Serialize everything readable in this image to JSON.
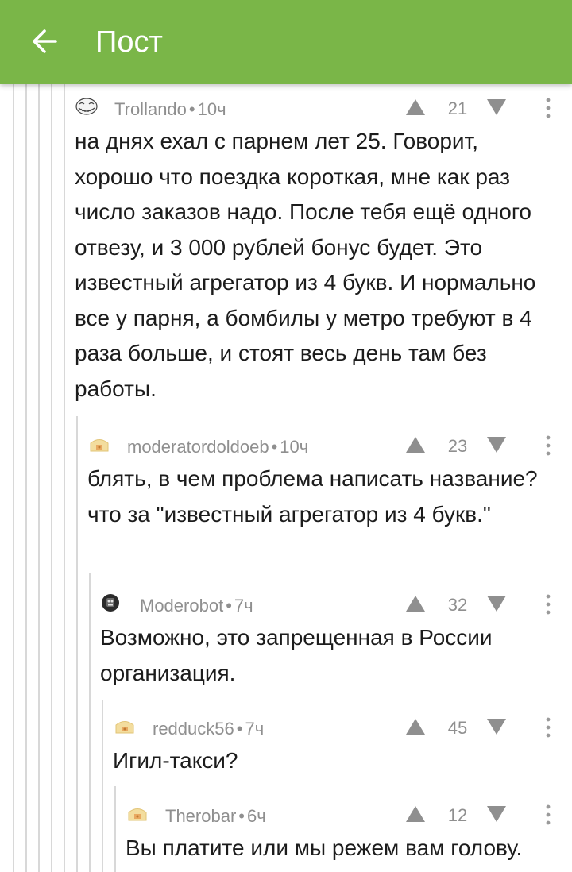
{
  "header": {
    "title": "Пост",
    "back_icon": "arrow-left-icon",
    "bg_color": "#7ab648"
  },
  "comments": [
    {
      "author": "Trollando",
      "time": "10ч",
      "score": "21",
      "avatar": "troll-face-avatar",
      "text": "на днях ехал с парнем лет 25. Говорит, хорошо что поездка короткая, мне как раз число заказов надо. После тебя ещё одного отвезу, и 3 000 рублей бонус будет. Это известный агрегатор из 4 букв. И нормально все у парня, а бомбилы у метро требуют в 4 раза больше, и стоят весь день там без работы."
    },
    {
      "author": "moderatordoldoeb",
      "time": "10ч",
      "score": "23",
      "avatar": "default-avatar",
      "text": "блять, в чем проблема написать название? что за \"известный агрегатор из 4 букв.\""
    },
    {
      "author": "Moderobot",
      "time": "7ч",
      "score": "32",
      "avatar": "robot-avatar",
      "text": "Возможно, это запрещенная в России организация."
    },
    {
      "author": "redduck56",
      "time": "7ч",
      "score": "45",
      "avatar": "default-avatar",
      "text": "Игил-такси?"
    },
    {
      "author": "Therobar",
      "time": "6ч",
      "score": "12",
      "avatar": "default-avatar",
      "text": "Вы платите или мы режем вам голову."
    }
  ],
  "separator": "•"
}
